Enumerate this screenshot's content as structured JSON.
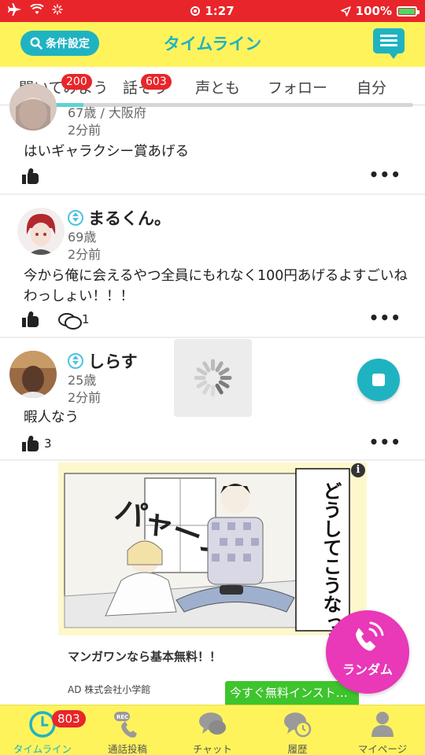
{
  "status_bar": {
    "time": "1:27",
    "battery_percent": "100%"
  },
  "header": {
    "filter_button": "条件設定",
    "title": "タイムライン"
  },
  "tabs": [
    {
      "label": "聞いてみよう",
      "badge": "200"
    },
    {
      "label": "話そう",
      "badge": "603"
    },
    {
      "label": "声とも",
      "badge": ""
    },
    {
      "label": "フォロー",
      "badge": ""
    },
    {
      "label": "自分",
      "badge": ""
    }
  ],
  "posts": [
    {
      "meta_line1": "67歳 / 大阪府",
      "time": "2分前",
      "body": "はいギャラクシー賞あげる",
      "like_count": "",
      "comment_count": ""
    },
    {
      "name": "まるくん。",
      "meta_line1": "69歳",
      "time": "2分前",
      "body": "今から俺に会えるやつ全員にもれなく100円あげるよすごいねわっしょい！！！",
      "like_count": "",
      "comment_count": "1"
    },
    {
      "name": "しらす",
      "meta_line1": "25歳",
      "time": "2分前",
      "body": "暇人なう",
      "like_count": "3",
      "comment_count": ""
    }
  ],
  "ad": {
    "manga_text": "どうしてこうなった——",
    "sfx_text": "パャーン",
    "title": "マンガワンなら基本無料！！",
    "sponsor": "AD 株式会社小学館",
    "install_button": "今すぐ無料インスト…",
    "info_label": "i"
  },
  "random_button": {
    "label": "ランダム"
  },
  "bottom_nav": [
    {
      "label": "タイムライン",
      "badge": "803",
      "active": true
    },
    {
      "label": "通話投稿",
      "badge": "",
      "active": false
    },
    {
      "label": "チャット",
      "badge": "",
      "active": false
    },
    {
      "label": "履歴",
      "badge": "",
      "active": false
    },
    {
      "label": "マイページ",
      "badge": "",
      "active": false
    }
  ],
  "colors": {
    "status_bar": "#e8252a",
    "header_bg": "#fff35c",
    "accent": "#1fb3c2",
    "badge": "#e8252a",
    "random_button": "#e938b8",
    "install_button": "#3ec42d"
  }
}
